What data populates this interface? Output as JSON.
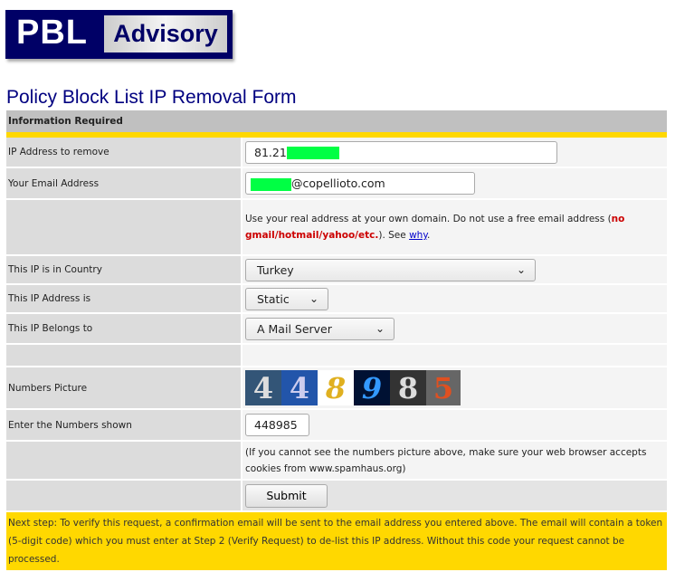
{
  "logo": {
    "part1": "PBL",
    "part2": "Advisory"
  },
  "title": "Policy Block List IP Removal Form",
  "section": "Information Required",
  "fields": {
    "ip": {
      "label": "IP Address to remove",
      "value": "81.21"
    },
    "email": {
      "label": "Your Email Address",
      "value": "@copellioto.com"
    },
    "note": {
      "text1": "Use your real address at your own domain. Do not use a free email address (",
      "red": "no gmail/hotmail/yahoo/etc.",
      "text2": "). See ",
      "link": "why",
      "text3": "."
    },
    "country": {
      "label": "This IP is in Country",
      "value": "Turkey"
    },
    "ip_type": {
      "label": "This IP Address is",
      "value": "Static"
    },
    "belongs": {
      "label": "This IP Belongs to",
      "value": "A Mail Server"
    },
    "captcha": {
      "label": "Numbers Picture",
      "digits": [
        "4",
        "4",
        "8",
        "9",
        "8",
        "5"
      ]
    },
    "numbers": {
      "label": "Enter the Numbers shown",
      "value": "448985"
    },
    "cookie_note": "(If you cannot see the numbers picture above, make sure your web browser accepts cookies from www.spamhaus.org)"
  },
  "submit": "Submit",
  "next_step": "Next step: To verify this request, a confirmation email will be sent to the email address you entered above. The email will contain a token (5-digit code) which you must enter at Step 2 (Verify Request) to de-list this IP address. Without this code your request cannot be processed."
}
